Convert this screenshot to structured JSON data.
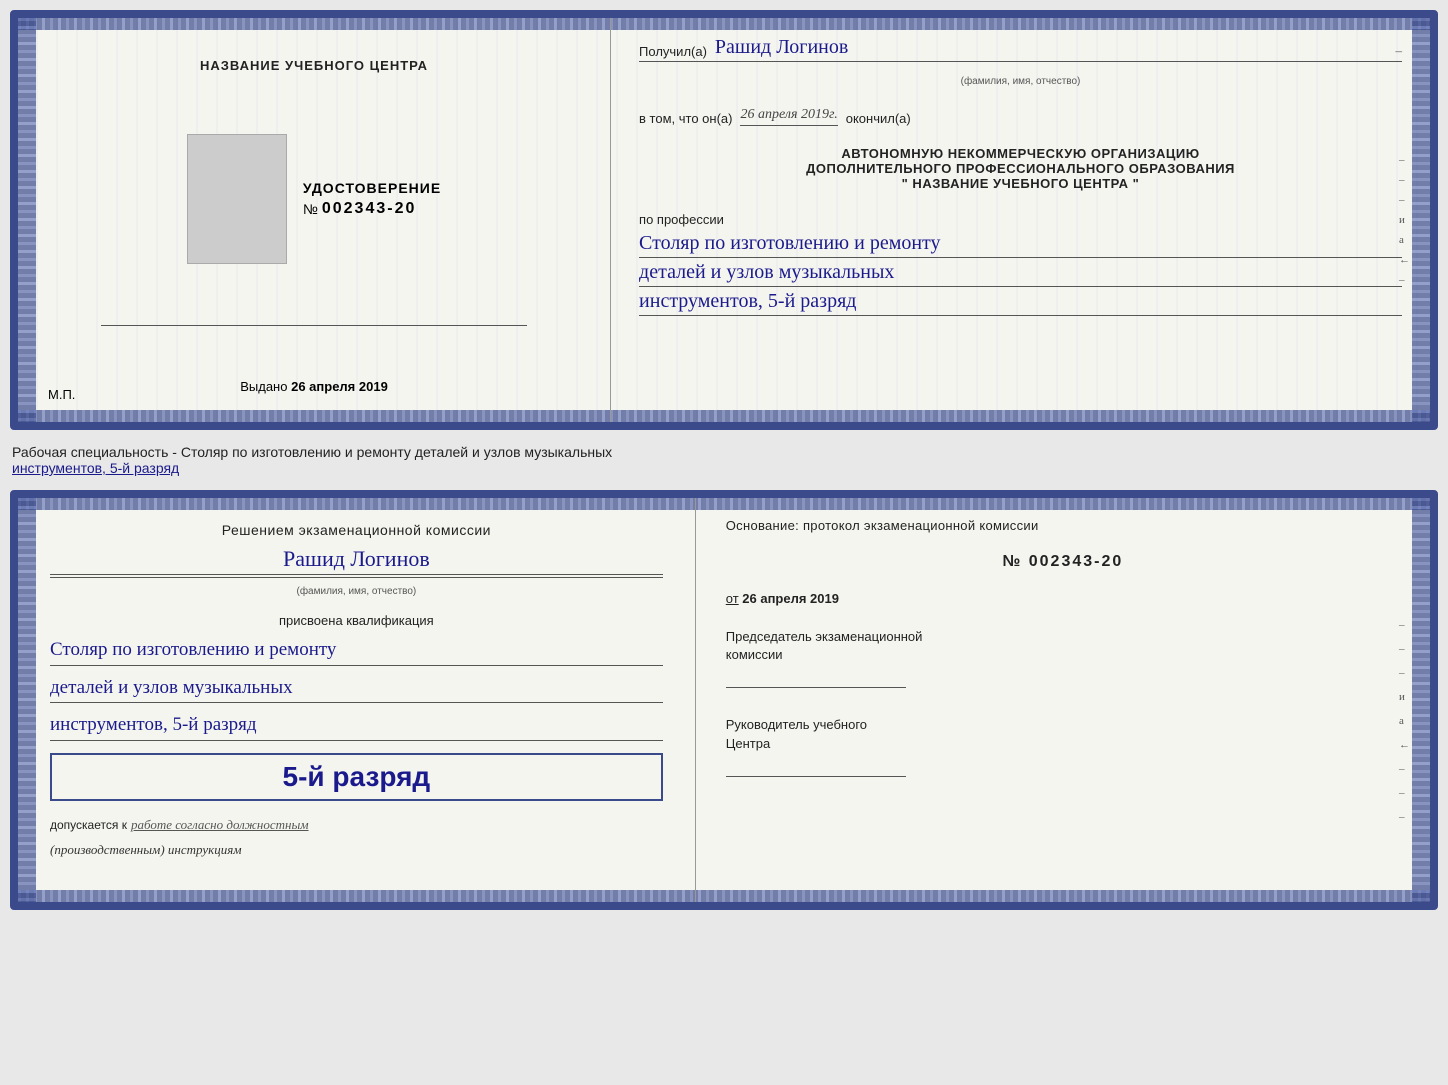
{
  "top_card": {
    "left": {
      "title": "НАЗВАНИЕ УЧЕБНОГО ЦЕНТРА",
      "udostoverenie_label": "УДОСТОВЕРЕНИЕ",
      "number_prefix": "№",
      "number": "002343-20",
      "issued_label": "Выдано",
      "issued_date": "26 апреля 2019",
      "mp_label": "М.П."
    },
    "right": {
      "received_label": "Получил(а)",
      "recipient_name": "Рашид Логинов",
      "fio_sublabel": "(фамилия, имя, отчество)",
      "in_that_label": "в том, что он(а)",
      "completion_date": "26 апреля 2019г.",
      "completed_label": "окончил(а)",
      "org_line1": "АВТОНОМНУЮ НЕКОММЕРЧЕСКУЮ ОРГАНИЗАЦИЮ",
      "org_line2": "ДОПОЛНИТЕЛЬНОГО ПРОФЕССИОНАЛЬНОГО ОБРАЗОВАНИЯ",
      "org_name": "\"   НАЗВАНИЕ УЧЕБНОГО ЦЕНТРА   \"",
      "by_profession": "по профессии",
      "profession_line1": "Столяр по изготовлению и ремонту",
      "profession_line2": "деталей и узлов музыкальных",
      "profession_line3": "инструментов, 5-й разряд",
      "side_marks": [
        "–",
        "–",
        "–",
        "и",
        "а",
        "←",
        "–"
      ]
    }
  },
  "specialty_line": {
    "label": "Рабочая специальность - Столяр по изготовлению и ремонту деталей и узлов музыкальных",
    "underline_part": "инструментов, 5-й разряд"
  },
  "bottom_card": {
    "left": {
      "decision_text": "Решением экзаменационной комиссии",
      "recipient_name": "Рашид Логинов",
      "fio_sublabel": "(фамилия, имя, отчество)",
      "assigned_text": "присвоена квалификация",
      "qual_line1": "Столяр по изготовлению и ремонту",
      "qual_line2": "деталей и узлов музыкальных",
      "qual_line3": "инструментов, 5-й разряд",
      "big_rank": "5-й разряд",
      "допускается_label": "допускается к",
      "допускается_value": "работе согласно должностным",
      "инструкциям_value": "(производственным) инструкциям"
    },
    "right": {
      "osnov_label": "Основание: протокол экзаменационной комиссии",
      "number_prefix": "№",
      "protocol_number": "002343-20",
      "date_label": "от",
      "date_value": "26 апреля 2019",
      "chairman_label": "Председатель экзаменационной",
      "chairman_label2": "комиссии",
      "head_label": "Руководитель учебного",
      "head_label2": "Центра",
      "side_marks": [
        "–",
        "–",
        "–",
        "и",
        "а",
        "←",
        "–",
        "–",
        "–"
      ]
    }
  }
}
